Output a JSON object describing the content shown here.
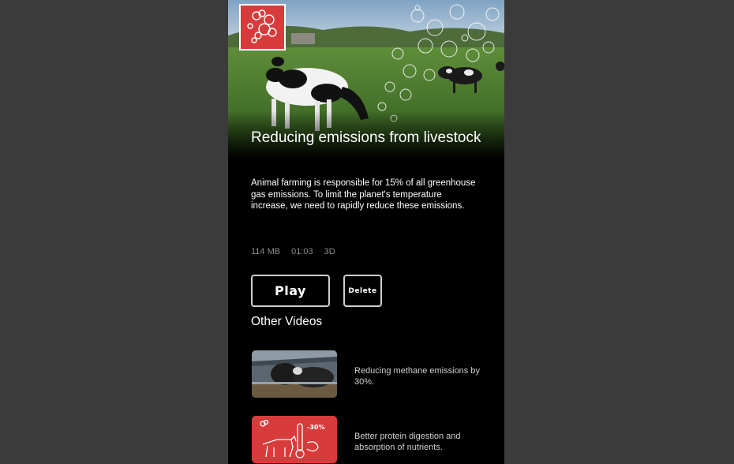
{
  "video": {
    "title": "Reducing emissions from livestock",
    "description": "Animal farming is responsible for 15% of all greenhouse gas emissions. To limit the planet's temperature increase, we need to rapidly reduce these emissions.",
    "meta": {
      "size": "114 MB",
      "duration": "01:03",
      "format": "3D"
    },
    "badge_icon": "gas-cloud-icon"
  },
  "actions": {
    "play_label": "Play",
    "delete_label": "Delete"
  },
  "other_videos": {
    "heading": "Other Videos",
    "items": [
      {
        "label": "Reducing methane emissions by 30%.",
        "thumb": "cows-in-barn"
      },
      {
        "label": "Better protein digestion and absorption of nutrients.",
        "thumb": "cow-thermometer-icon",
        "thumb_text": "-30%"
      }
    ]
  },
  "colors": {
    "background": "#000000",
    "accent": "#d83b3b",
    "meta_text": "#8c8c8c"
  }
}
